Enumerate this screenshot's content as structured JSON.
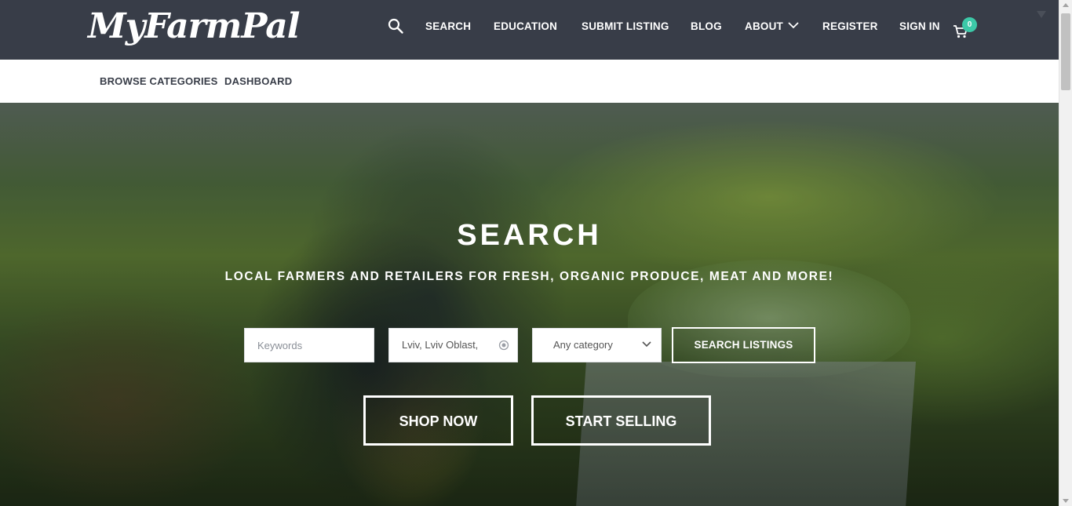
{
  "brand": {
    "logo_text": "MyFarmPal"
  },
  "nav": {
    "items": [
      {
        "label": "SEARCH"
      },
      {
        "label": "EDUCATION"
      },
      {
        "label": "SUBMIT LISTING"
      },
      {
        "label": "BLOG"
      },
      {
        "label": "ABOUT"
      },
      {
        "label": "REGISTER"
      },
      {
        "label": "SIGN IN"
      }
    ],
    "cart_count": "0"
  },
  "subnav": {
    "items": [
      {
        "label": "BROWSE CATEGORIES"
      },
      {
        "label": "DASHBOARD"
      }
    ]
  },
  "hero": {
    "title": "SEARCH",
    "subtitle": "LOCAL FARMERS AND RETAILERS FOR FRESH, ORGANIC PRODUCE, MEAT AND MORE!",
    "keywords_placeholder": "Keywords",
    "location_value": "Lviv, Lviv Oblast,",
    "category_value": "Any category",
    "search_button": "SEARCH LISTINGS",
    "shop_button": "SHOP NOW",
    "sell_button": "START SELLING"
  },
  "colors": {
    "header_bg": "#383d48",
    "accent": "#3cc9a8"
  }
}
